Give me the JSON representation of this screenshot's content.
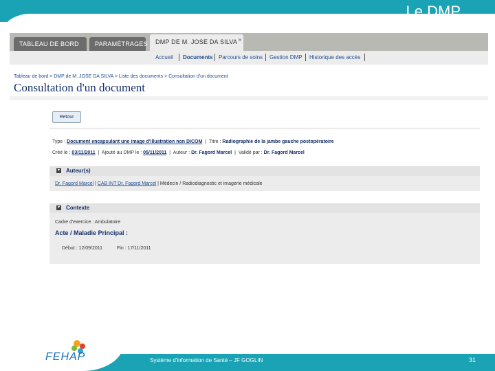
{
  "slide": {
    "title": "Le DMP",
    "footer": "Système d'information de Santé – JF GOGLIN",
    "page_number": "31",
    "logo_text": "FEHAP",
    "colors": {
      "band": "#1aa3b5",
      "logo_blue": "#1e6fb8"
    }
  },
  "app": {
    "tabs": [
      {
        "label": "TABLEAU DE BORD"
      },
      {
        "label": "PARAMÈTRAGES"
      },
      {
        "label": "DMP DE M. JOSE DA SILVA"
      }
    ],
    "tab_close": "»",
    "subnav": [
      "Accueil",
      "Documents",
      "Parcours de soins",
      "Gestion DMP",
      "Historique des accès"
    ],
    "breadcrumb": "Tableau de bord > DMP de M. JOSE DA SILVA > Liste des documents > Consultation d'un document",
    "page_title": "Consultation d'un document",
    "retour": "Retour",
    "doc": {
      "type_label": "Type :",
      "type_value": "Document encapsulant une image d'illustration non DICOM",
      "titre_label": "Titre :",
      "titre_value": "Radiographie de la jambe gauche postopératoire",
      "cree_label": "Créé le :",
      "cree_value": "03/11/2011",
      "ajoute_label": "Ajouté au DMP le :",
      "ajoute_value": "05/11/2011",
      "auteur_label": "Auteur :",
      "auteur_value": "Dr. Fagord Marcel",
      "valide_label": "Validé par :",
      "valide_value": "Dr. Fagord Marcel"
    },
    "auteurs": {
      "heading": "Auteur(s)",
      "link1": "Dr. Fagord Marcel",
      "link2": "CAB INT Dr. Fagord Marcel",
      "specialty": "Médecin / Radiodiagnostic et imagerie médicale"
    },
    "contexte": {
      "heading": "Contexte",
      "cadre": "Cadre d'exercice : Ambulatoire",
      "acte": "Acte / Maladie Principal :",
      "debut": "Début : 12/09/2011",
      "fin": "Fin : 17/11/2011"
    }
  }
}
